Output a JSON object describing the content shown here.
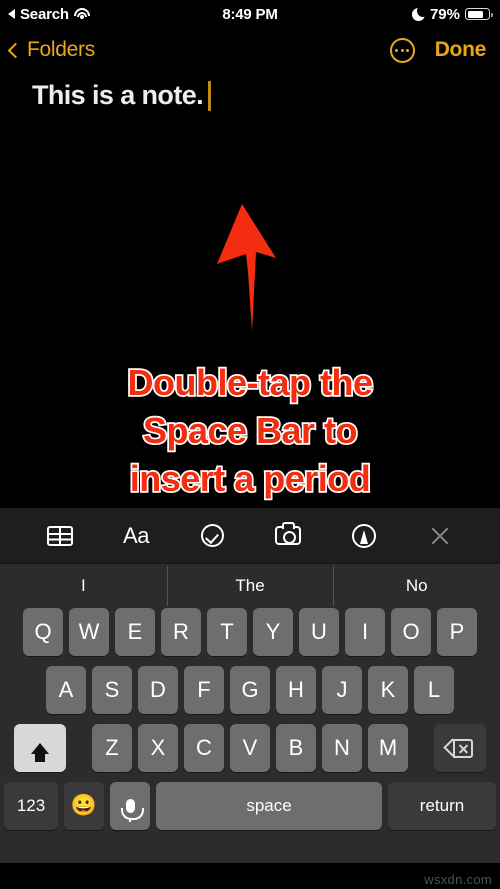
{
  "status_bar": {
    "carrier_back_label": "Search",
    "back_icon": "back-triangle-icon",
    "wifi_icon": "wifi-icon",
    "time": "8:49 PM",
    "dnd_icon": "moon-icon",
    "battery_percent": "79%",
    "battery_fill": 79
  },
  "nav_bar": {
    "back_icon": "chevron-left-icon",
    "back_label": "Folders",
    "more_icon": "ellipsis-circle-icon",
    "done_label": "Done",
    "accent_color": "#E6A817"
  },
  "note": {
    "title": "This is a note.",
    "caret_color": "#C08A16"
  },
  "annotation": {
    "arrow_icon": "up-arrow-annotation-icon",
    "arrow_color": "#F42D10",
    "text_color": "#F42D10",
    "outline_color": "#FFFFFF",
    "lines": [
      "Double-tap the",
      "Space Bar to",
      "insert a period"
    ]
  },
  "toolbar": {
    "items": [
      {
        "name": "table-icon",
        "label": ""
      },
      {
        "name": "format-aa-icon",
        "label": "Aa"
      },
      {
        "name": "checklist-icon",
        "label": ""
      },
      {
        "name": "camera-icon",
        "label": ""
      },
      {
        "name": "markup-pen-icon",
        "label": ""
      },
      {
        "name": "close-icon",
        "label": ""
      }
    ],
    "aa_label": "Aa"
  },
  "keyboard": {
    "predictions": [
      "I",
      "The",
      "No"
    ],
    "row1": [
      "Q",
      "W",
      "E",
      "R",
      "T",
      "Y",
      "U",
      "I",
      "O",
      "P"
    ],
    "row2": [
      "A",
      "S",
      "D",
      "F",
      "G",
      "H",
      "J",
      "K",
      "L"
    ],
    "row3": [
      "Z",
      "X",
      "C",
      "V",
      "B",
      "N",
      "M"
    ],
    "shift_icon": "shift-arrow-icon",
    "shift_active": true,
    "delete_icon": "backspace-delete-icon",
    "numbers_label": "123",
    "emoji_icon": "emoji-smiley-icon",
    "emoji_glyph": "😀",
    "dictation_icon": "microphone-icon",
    "space_label": "space",
    "return_label": "return"
  },
  "watermark": "wsxdn.com"
}
